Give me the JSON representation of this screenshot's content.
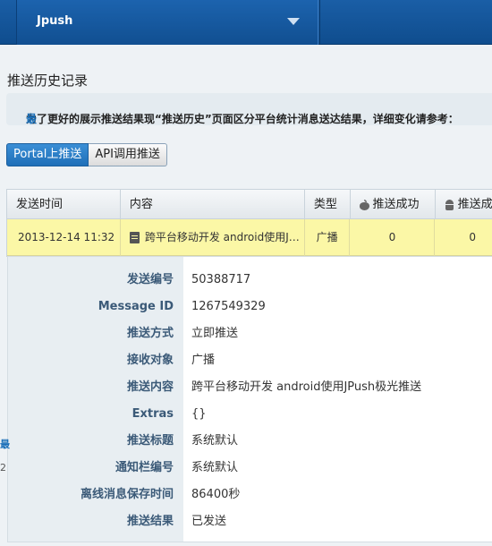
{
  "topbar": {
    "app_name": "Jpush"
  },
  "page_title": "推送历史记录",
  "notice": {
    "text": "为了更好的展示推送结果现“推送历史”页面区分平台统计消息送达结果，详细变化请参考：",
    "link": "最"
  },
  "tabs": [
    {
      "label": "Portal上推送",
      "active": true
    },
    {
      "label": "API调用推送",
      "active": false
    }
  ],
  "table": {
    "headers": {
      "send_time": "发送时间",
      "content": "内容",
      "type": "类型",
      "ios_success": "推送成功",
      "android_success": "推送成"
    },
    "row": {
      "send_time": "2013-12-14 11:32",
      "content": "跨平台移动开发 android使用JPush极光推送",
      "type": "广播",
      "ios_success": "0",
      "android_success": "0"
    }
  },
  "detail": {
    "fields": [
      {
        "label": "发送编号",
        "value": "50388717"
      },
      {
        "label": "Message ID",
        "value": "1267549329"
      },
      {
        "label": "推送方式",
        "value": "立即推送"
      },
      {
        "label": "接收对象",
        "value": "广播"
      },
      {
        "label": "推送内容",
        "value": "跨平台移动开发 android使用JPush极光推送"
      },
      {
        "label": "Extras",
        "value": "{}"
      },
      {
        "label": "推送标题",
        "value": "系统默认"
      },
      {
        "label": "通知栏编号",
        "value": "系统默认"
      },
      {
        "label": "离线消息保存时间",
        "value": "86400秒"
      },
      {
        "label": "推送结果",
        "value": "已发送"
      }
    ]
  },
  "edge_glyphs": {
    "a": "最",
    "b": "2"
  },
  "colors": {
    "topbar": "#1a5ea6",
    "tab_active": "#2a7cc7",
    "highlight_row": "#fbf7a6",
    "detail_label": "#3b5a78"
  }
}
